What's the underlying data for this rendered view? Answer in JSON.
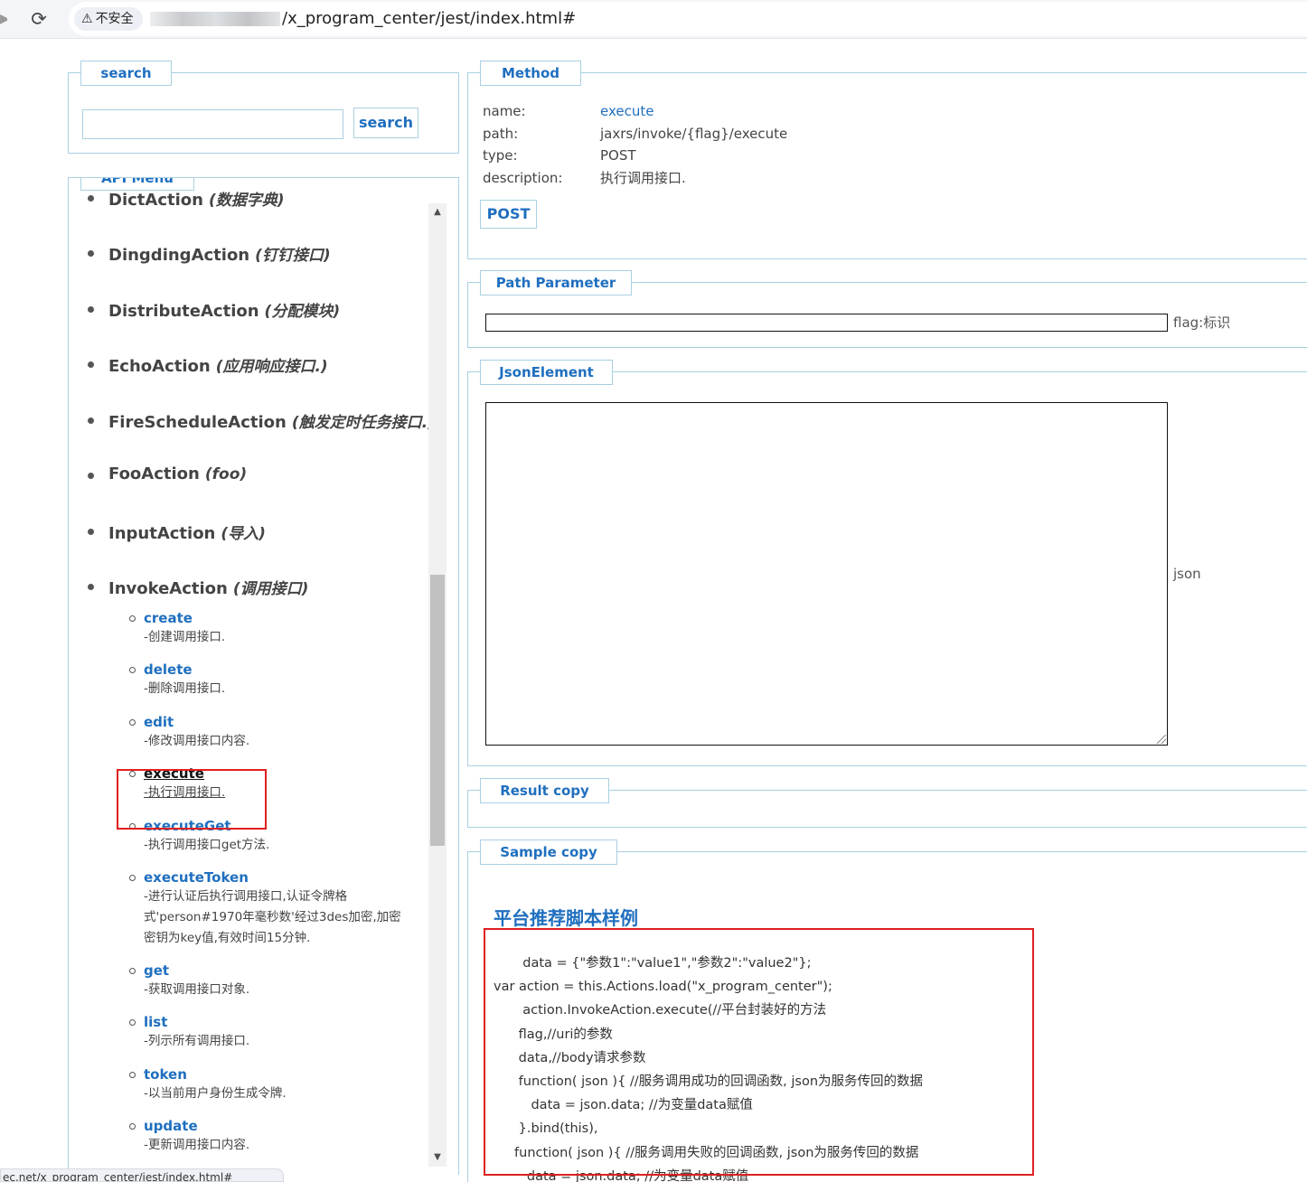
{
  "browser": {
    "security_label": "不安全",
    "url_path": "/x_program_center/jest/index.html#"
  },
  "search": {
    "legend": "search",
    "input_value": "",
    "button_label": "search"
  },
  "api_menu": {
    "legend": "API Menu",
    "actions": [
      {
        "name": "DictAction",
        "desc": "(数据字典)"
      },
      {
        "name": "DingdingAction",
        "desc": "(钉钉接口)"
      },
      {
        "name": "DistributeAction",
        "desc": "(分配模块)"
      },
      {
        "name": "EchoAction",
        "desc": "(应用响应接口.)"
      },
      {
        "name": "FireScheduleAction",
        "desc": "(触发定时任务接口.)"
      },
      {
        "name": "FooAction",
        "desc": "(foo)"
      },
      {
        "name": "InputAction",
        "desc": "(导入)"
      },
      {
        "name": "InvokeAction",
        "desc": "(调用接口)"
      }
    ],
    "methods": [
      {
        "name": "create",
        "desc": "-创建调用接口."
      },
      {
        "name": "delete",
        "desc": "-删除调用接口."
      },
      {
        "name": "edit",
        "desc": "-修改调用接口内容."
      },
      {
        "name": "execute",
        "desc": "-执行调用接口."
      },
      {
        "name": "executeGet",
        "desc": "-执行调用接口get方法."
      },
      {
        "name": "executeToken",
        "desc_lines": [
          "-进行认证后执行调用接口,认证令牌格",
          "式'person#1970年毫秒数'经过3des加密,加密",
          "密钥为key值,有效时间15分钟."
        ]
      },
      {
        "name": "get",
        "desc": "-获取调用接口对象."
      },
      {
        "name": "list",
        "desc": "-列示所有调用接口."
      },
      {
        "name": "token",
        "desc": "-以当前用户身份生成令牌."
      },
      {
        "name": "update",
        "desc": "-更新调用接口内容."
      }
    ],
    "selected_method": "execute"
  },
  "status_bar": {
    "text": "ec.net/x_program_center/jest/index.html#"
  },
  "method": {
    "legend": "Method",
    "name_label": "name:",
    "name_value": "execute",
    "path_label": "path:",
    "path_value": "jaxrs/invoke/{flag}/execute",
    "type_label": "type:",
    "type_value": "POST",
    "description_label": "description:",
    "description_value": "执行调用接口.",
    "submit_label": "POST"
  },
  "path_parameter": {
    "legend": "Path Parameter",
    "flag_value": "",
    "flag_label": "flag:标识"
  },
  "json_element": {
    "legend": "JsonElement",
    "value": "",
    "label": "json"
  },
  "result": {
    "legend": "Result copy"
  },
  "sample": {
    "legend": "Sample copy",
    "title": "平台推荐脚本样例",
    "code_lines": [
      "       data = {\"参数1\":\"value1\",\"参数2\":\"value2\"};",
      "var action = this.Actions.load(\"x_program_center\");",
      "       action.InvokeAction.execute(//平台封装好的方法",
      "      flag,//uri的参数",
      "      data,//body请求参数",
      "      function( json ){ //服务调用成功的回调函数, json为服务传回的数据",
      "         data = json.data; //为变量data赋值",
      "      }.bind(this),",
      "     function( json ){ //服务调用失败的回调函数, json为服务传回的数据",
      "        data = json.data; //为变量data赋值"
    ]
  },
  "colors": {
    "accent": "#1f6fbf",
    "border": "#a9d0e2",
    "highlight": "#e02020"
  }
}
